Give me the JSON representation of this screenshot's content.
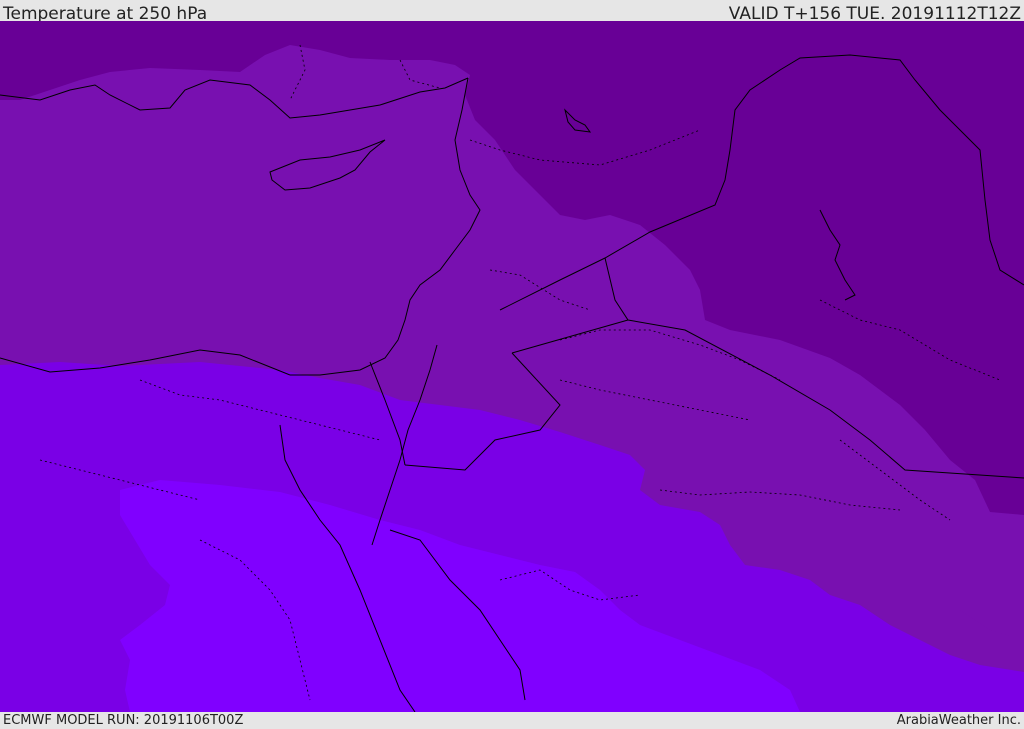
{
  "header": {
    "title": "Temperature at 250 hPa",
    "valid": "VALID T+156 TUE. 20191112T12Z"
  },
  "footer": {
    "model_run": "ECMWF MODEL RUN: 20191106T00Z",
    "credit": "ArabiaWeather Inc."
  },
  "legend_colors": {
    "coldest": "#680096",
    "cold": "#7810b0",
    "mild": "#7a00d8",
    "warm": "#7d00f5",
    "warmest": "#8000ff"
  }
}
